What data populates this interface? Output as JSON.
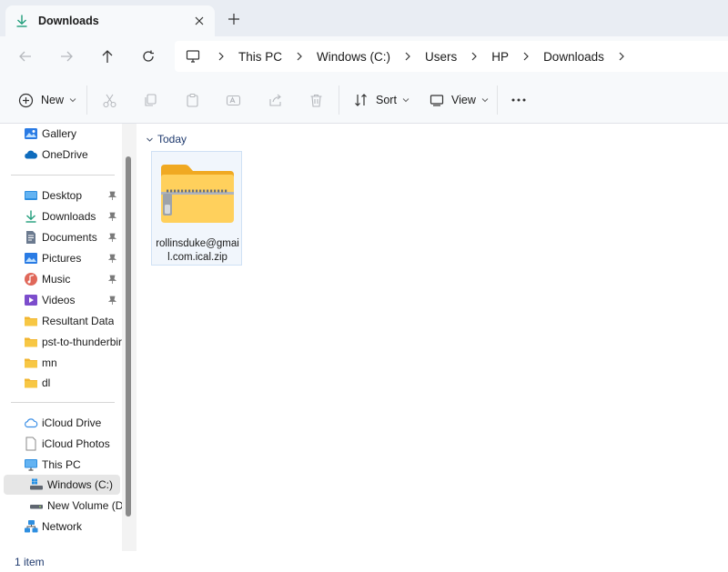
{
  "window": {
    "tab_title": "Downloads",
    "new_tab_label": "+"
  },
  "address": {
    "crumbs": [
      "This PC",
      "Windows (C:)",
      "Users",
      "HP",
      "Downloads"
    ]
  },
  "toolbar": {
    "new_label": "New",
    "sort_label": "Sort",
    "view_label": "View"
  },
  "sidebar": {
    "quick": [
      {
        "label": "Gallery",
        "icon": "gallery-icon"
      },
      {
        "label": "OneDrive",
        "icon": "onedrive-icon"
      }
    ],
    "pinned": [
      {
        "label": "Desktop",
        "icon": "desktop-folder-icon",
        "pinned": true
      },
      {
        "label": "Downloads",
        "icon": "downloads-folder-icon",
        "pinned": true
      },
      {
        "label": "Documents",
        "icon": "documents-folder-icon",
        "pinned": true
      },
      {
        "label": "Pictures",
        "icon": "pictures-folder-icon",
        "pinned": true
      },
      {
        "label": "Music",
        "icon": "music-folder-icon",
        "pinned": true
      },
      {
        "label": "Videos",
        "icon": "videos-folder-icon",
        "pinned": true
      },
      {
        "label": "Resultant Data",
        "icon": "folder-icon",
        "pinned": false
      },
      {
        "label": "pst-to-thunderbir",
        "icon": "folder-icon",
        "pinned": false
      },
      {
        "label": "mn",
        "icon": "folder-icon",
        "pinned": false
      },
      {
        "label": "dl",
        "icon": "folder-icon",
        "pinned": false
      }
    ],
    "devices": [
      {
        "label": "iCloud Drive",
        "icon": "icloud-drive-icon"
      },
      {
        "label": "iCloud Photos",
        "icon": "icloud-photos-icon"
      },
      {
        "label": "This PC",
        "icon": "this-pc-icon"
      },
      {
        "label": "Windows (C:)",
        "icon": "drive-c-icon",
        "selected": true
      },
      {
        "label": "New Volume (D:",
        "icon": "drive-d-icon"
      },
      {
        "label": "Network",
        "icon": "network-icon"
      }
    ]
  },
  "content": {
    "group_label": "Today",
    "files": [
      {
        "name": "rollinsduke@gmail.com.ical.zip",
        "icon": "zip-folder-icon"
      }
    ]
  },
  "status": {
    "item_count": "1 item"
  },
  "colors": {
    "accent": "#0a62c4",
    "folder": "#f7c744",
    "selection": "#e6e6e6"
  }
}
